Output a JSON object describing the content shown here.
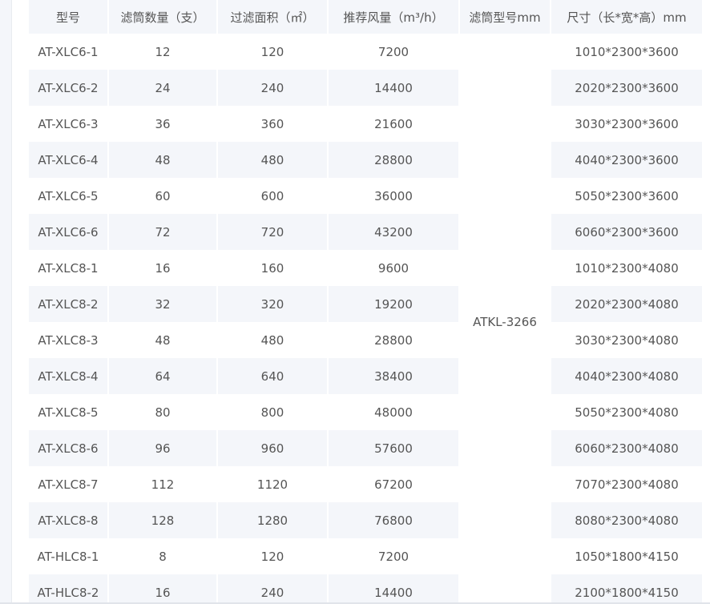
{
  "table": {
    "headers": [
      "型号",
      "滤筒数量（支）",
      "过滤面积（㎡）",
      "推荐风量（m³/h）",
      "滤筒型号mm",
      "尺寸（长*宽*高）mm"
    ],
    "filter_model": "ATKL-3266",
    "rows": [
      {
        "model": "AT-XLC6-1",
        "count": "12",
        "area": "120",
        "airflow": "7200",
        "size": "1010*2300*3600"
      },
      {
        "model": "AT-XLC6-2",
        "count": "24",
        "area": "240",
        "airflow": "14400",
        "size": "2020*2300*3600"
      },
      {
        "model": "AT-XLC6-3",
        "count": "36",
        "area": "360",
        "airflow": "21600",
        "size": "3030*2300*3600"
      },
      {
        "model": "AT-XLC6-4",
        "count": "48",
        "area": "480",
        "airflow": "28800",
        "size": "4040*2300*3600"
      },
      {
        "model": "AT-XLC6-5",
        "count": "60",
        "area": "600",
        "airflow": "36000",
        "size": "5050*2300*3600"
      },
      {
        "model": "AT-XLC6-6",
        "count": "72",
        "area": "720",
        "airflow": "43200",
        "size": "6060*2300*3600"
      },
      {
        "model": "AT-XLC8-1",
        "count": "16",
        "area": "160",
        "airflow": "9600",
        "size": "1010*2300*4080"
      },
      {
        "model": "AT-XLC8-2",
        "count": "32",
        "area": "320",
        "airflow": "19200",
        "size": "2020*2300*4080"
      },
      {
        "model": "AT-XLC8-3",
        "count": "48",
        "area": "480",
        "airflow": "28800",
        "size": "3030*2300*4080"
      },
      {
        "model": "AT-XLC8-4",
        "count": "64",
        "area": "640",
        "airflow": "38400",
        "size": "4040*2300*4080"
      },
      {
        "model": "AT-XLC8-5",
        "count": "80",
        "area": "800",
        "airflow": "48000",
        "size": "5050*2300*4080"
      },
      {
        "model": "AT-XLC8-6",
        "count": "96",
        "area": "960",
        "airflow": "57600",
        "size": "6060*2300*4080"
      },
      {
        "model": "AT-XLC8-7",
        "count": "112",
        "area": "1120",
        "airflow": "67200",
        "size": "7070*2300*4080"
      },
      {
        "model": "AT-XLC8-8",
        "count": "128",
        "area": "1280",
        "airflow": "76800",
        "size": "8080*2300*4080"
      },
      {
        "model": "AT-HLC8-1",
        "count": "8",
        "area": "120",
        "airflow": "7200",
        "size": "1050*1800*4150"
      },
      {
        "model": "AT-HLC8-2",
        "count": "16",
        "area": "240",
        "airflow": "14400",
        "size": "2100*1800*4150"
      }
    ]
  }
}
